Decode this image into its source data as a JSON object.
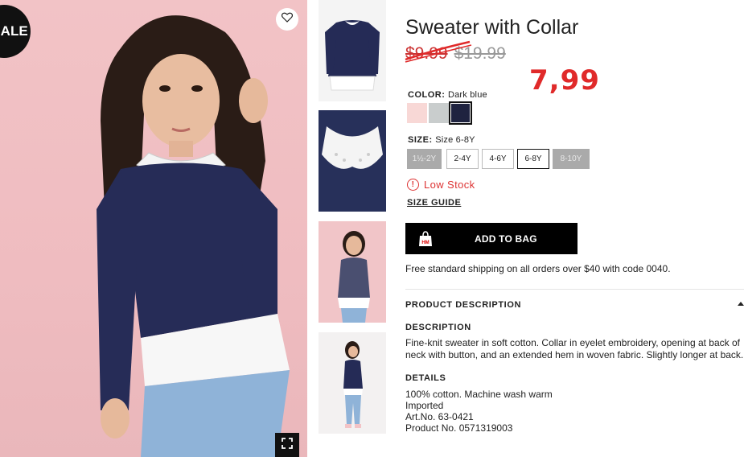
{
  "badge": {
    "sale": "SALE"
  },
  "product": {
    "title": "Sweater with Collar",
    "price_old1": "$9.99",
    "price_old2": "$19.99",
    "price_new": "7,99"
  },
  "color": {
    "label": "COLOR:",
    "value": "Dark blue",
    "swatches": [
      "#f8d8d6",
      "#c9cdcd",
      "#1f2340"
    ]
  },
  "size": {
    "label": "SIZE:",
    "value": "Size 6-8Y",
    "options": [
      "1½-2Y",
      "2-4Y",
      "4-6Y",
      "6-8Y",
      "8-10Y"
    ]
  },
  "stock": {
    "text": "Low Stock",
    "icon": "alert-circle-icon"
  },
  "size_guide": "SIZE GUIDE",
  "add_to_bag": "ADD TO BAG",
  "shipping": "Free standard shipping on all orders over $40 with code 0040.",
  "description_section": {
    "header": "PRODUCT DESCRIPTION",
    "description_label": "DESCRIPTION",
    "description_text": "Fine-knit sweater in soft cotton. Collar in eyelet embroidery, opening at back of neck with button, and an extended hem in woven fabric. Slightly longer at back.",
    "details_label": "DETAILS",
    "details": [
      "100% cotton. Machine wash warm",
      "Imported",
      "Art.No. 63-0421",
      "Product No. 0571319003"
    ]
  },
  "colors": {
    "accent_red": "#e02a2a",
    "low_stock_red": "#dd3333",
    "button_black": "#000000"
  }
}
